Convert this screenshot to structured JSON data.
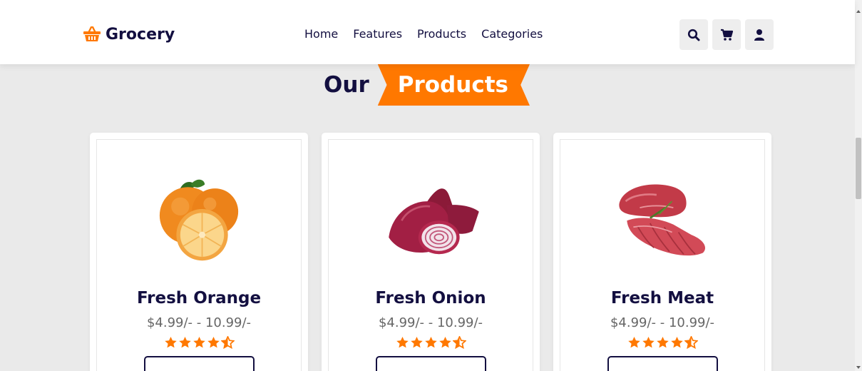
{
  "brand": {
    "name": "Grocery",
    "icon": "basket-icon",
    "color": "#ff7800"
  },
  "nav": {
    "items": [
      {
        "label": "Home"
      },
      {
        "label": "Features"
      },
      {
        "label": "Products"
      },
      {
        "label": "Categories"
      }
    ]
  },
  "header_icons": [
    "search-icon",
    "cart-icon",
    "user-icon"
  ],
  "section": {
    "title_plain": "Our",
    "title_highlight": "Products"
  },
  "products": [
    {
      "name": "Fresh Orange",
      "price": "$4.99/- - 10.99/-",
      "rating": 4.5,
      "image": "orange"
    },
    {
      "name": "Fresh Onion",
      "price": "$4.99/- - 10.99/-",
      "rating": 4.5,
      "image": "onion"
    },
    {
      "name": "Fresh Meat",
      "price": "$4.99/- - 10.99/-",
      "rating": 4.5,
      "image": "meat"
    }
  ],
  "colors": {
    "accent": "#ff7800",
    "dark": "#130f40",
    "background": "#eaeaea"
  }
}
